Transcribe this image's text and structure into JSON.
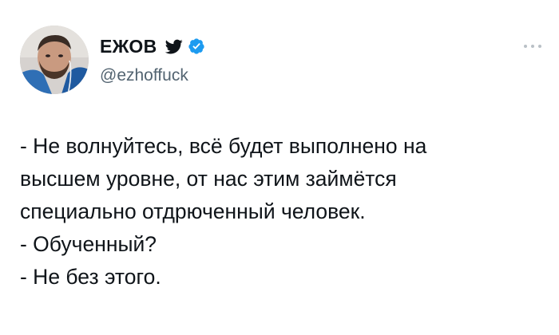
{
  "author": {
    "display_name": "ЕЖОВ",
    "handle": "@ezhoffuck",
    "avatar_icon": "user-photo",
    "bird_icon": "twitter-bird-icon",
    "verified_icon": "verified-badge-icon"
  },
  "menu": {
    "icon": "more-dots-icon"
  },
  "tweet": {
    "lines": [
      "- Не волнуйтесь, всё будет выполнено на",
      "высшем уровне, от нас этим займётся",
      "специально отдрюченный человек.",
      "- Обученный?",
      "- Не без этого."
    ]
  },
  "colors": {
    "text": "#0f1419",
    "secondary": "#536471",
    "verified": "#1d9bf0",
    "background": "#ffffff"
  }
}
